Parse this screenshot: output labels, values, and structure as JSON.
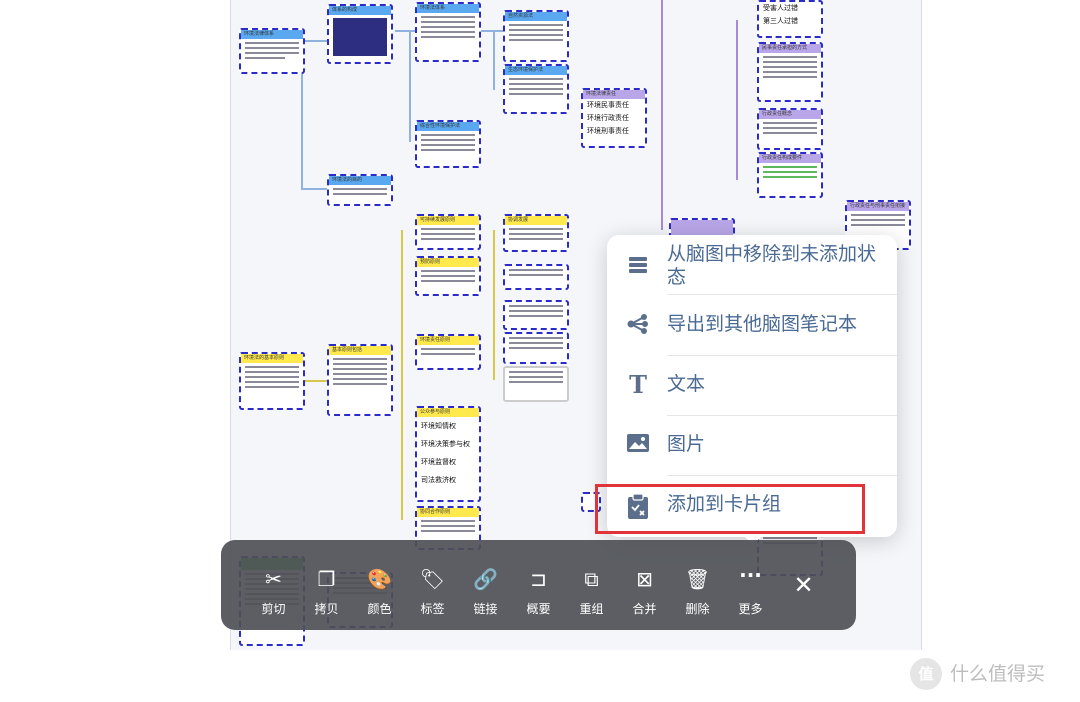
{
  "mindmap": {
    "nodes": [
      {
        "title": "环境法律体系",
        "kind": "blue"
      },
      {
        "title": "体系的构成",
        "kind": "blue"
      },
      {
        "title": "环境法体系",
        "kind": "blue"
      },
      {
        "title": "自然资源法",
        "kind": "blue"
      },
      {
        "title": "生态环境保护法",
        "kind": "blue"
      },
      {
        "title": "综合性环境保护法",
        "kind": "blue"
      },
      {
        "title": "环境法的目的",
        "kind": "blue"
      },
      {
        "title": "环境法律责任",
        "kind": "purple"
      },
      {
        "title": "环境法的基本原则",
        "kind": "yellow"
      },
      {
        "title": "基本原则包括",
        "kind": "yellow"
      },
      {
        "title": "可持续发展原则",
        "kind": "yellow"
      },
      {
        "title": "协调发展",
        "kind": "yellow"
      },
      {
        "title": "预防原则",
        "kind": "yellow"
      },
      {
        "title": "环境责任原则",
        "kind": "yellow"
      },
      {
        "title": "公众参与原则",
        "kind": "yellow"
      },
      {
        "title": "协同合作原则",
        "kind": "yellow"
      },
      {
        "title": "民事责任承担的方式",
        "kind": "purple"
      },
      {
        "title": "行政责任概念",
        "kind": "purple"
      },
      {
        "title": "行政责任构成要件",
        "kind": "purple"
      },
      {
        "title": "行政责任与刑事责任衔接",
        "kind": "purple"
      }
    ],
    "legal_liability_lines": [
      "环境民事责任",
      "环境行政责任",
      "环境刑事责任",
      "专门环境法律责任"
    ],
    "tort_lines": [
      "受害人过错",
      "第三人过错",
      "战争行为"
    ],
    "participation_lines": [
      "环境知情权",
      "环境决策参与权",
      "环境监督权",
      "司法救济权"
    ]
  },
  "context_menu": {
    "items": [
      {
        "label": "从脑图中移除到未添加状态",
        "icon": "list-icon"
      },
      {
        "label": "导出到其他脑图笔记本",
        "icon": "share-icon"
      },
      {
        "label": "文本",
        "icon": "text-icon"
      },
      {
        "label": "图片",
        "icon": "image-icon"
      },
      {
        "label": "添加到卡片组",
        "icon": "clipboard-icon"
      }
    ],
    "highlighted": "添加到卡片组"
  },
  "toolbar": {
    "buttons": [
      {
        "label": "剪切",
        "icon": "scissors-icon",
        "glyph": "✂"
      },
      {
        "label": "拷贝",
        "icon": "copy-icon",
        "glyph": "❐"
      },
      {
        "label": "颜色",
        "icon": "palette-icon",
        "glyph": "🎨"
      },
      {
        "label": "标签",
        "icon": "tag-icon",
        "glyph": "🏷"
      },
      {
        "label": "链接",
        "icon": "link-icon",
        "glyph": "🔗"
      },
      {
        "label": "概要",
        "icon": "summary-icon",
        "glyph": "⊐"
      },
      {
        "label": "重组",
        "icon": "reorganize-icon",
        "glyph": "⧉"
      },
      {
        "label": "合并",
        "icon": "merge-icon",
        "glyph": "⊠"
      },
      {
        "label": "删除",
        "icon": "trash-icon",
        "glyph": "🗑"
      },
      {
        "label": "更多",
        "icon": "more-icon",
        "glyph": "···"
      }
    ],
    "close_glyph": "✕"
  },
  "watermark": {
    "logo_text": "值",
    "text": "什么值得买"
  },
  "colors": {
    "accent_blue": "#4a6a94",
    "highlight_red": "#e0343a",
    "node_border": "#2b2bc9"
  }
}
